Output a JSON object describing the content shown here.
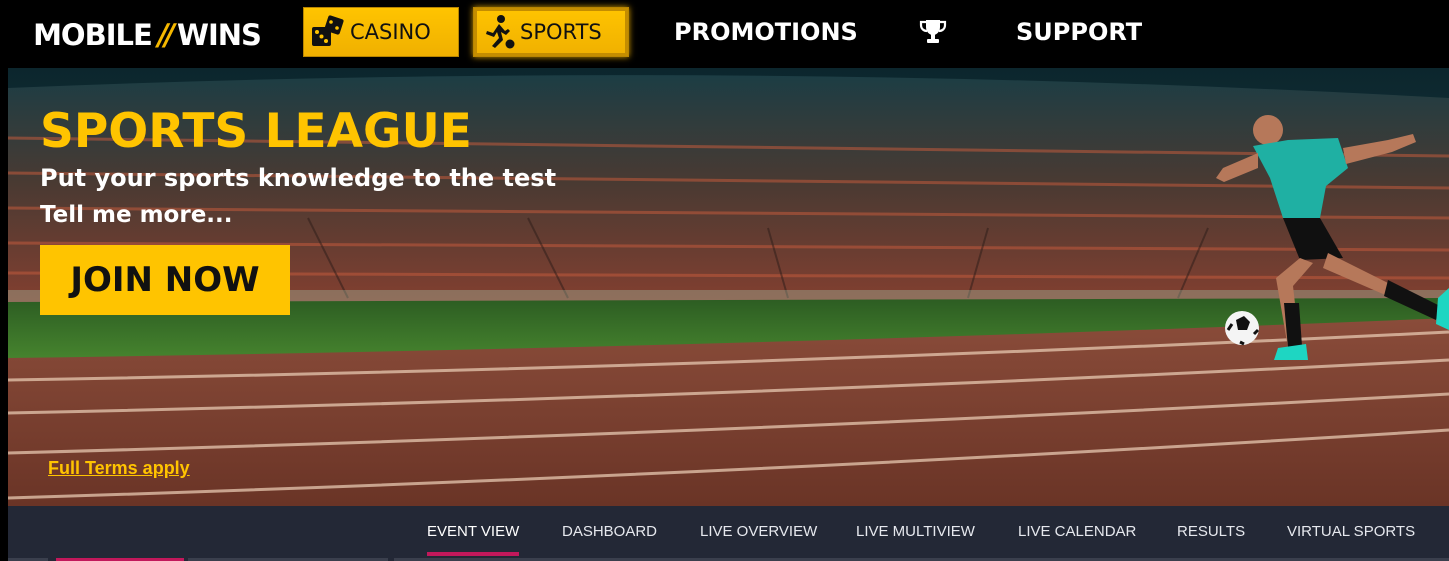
{
  "brand": {
    "logo_left": "MOBILE",
    "logo_slash": "//",
    "logo_right": "WINS"
  },
  "nav": {
    "casino": {
      "label": "CASINO",
      "icon": "dice-icon"
    },
    "sports": {
      "label": "SPORTS",
      "icon": "football-player-icon"
    },
    "promotions": "PROMOTIONS",
    "trophy_icon": "trophy-icon",
    "support": "SUPPORT"
  },
  "hero": {
    "title": "SPORTS LEAGUE",
    "subtitle": "Put your sports knowledge to the test",
    "more_link": "Tell me more...",
    "cta": "JOIN NOW",
    "terms_link": "Full Terms apply"
  },
  "subnav": {
    "tabs": [
      "EVENT VIEW",
      "DASHBOARD",
      "LIVE OVERVIEW",
      "LIVE MULTIVIEW",
      "LIVE CALENDAR",
      "RESULTS",
      "VIRTUAL SPORTS"
    ],
    "active_index": 0
  },
  "colors": {
    "accent": "#ffc400",
    "tab_underline": "#c2185b",
    "subnav_bg": "#232836"
  }
}
